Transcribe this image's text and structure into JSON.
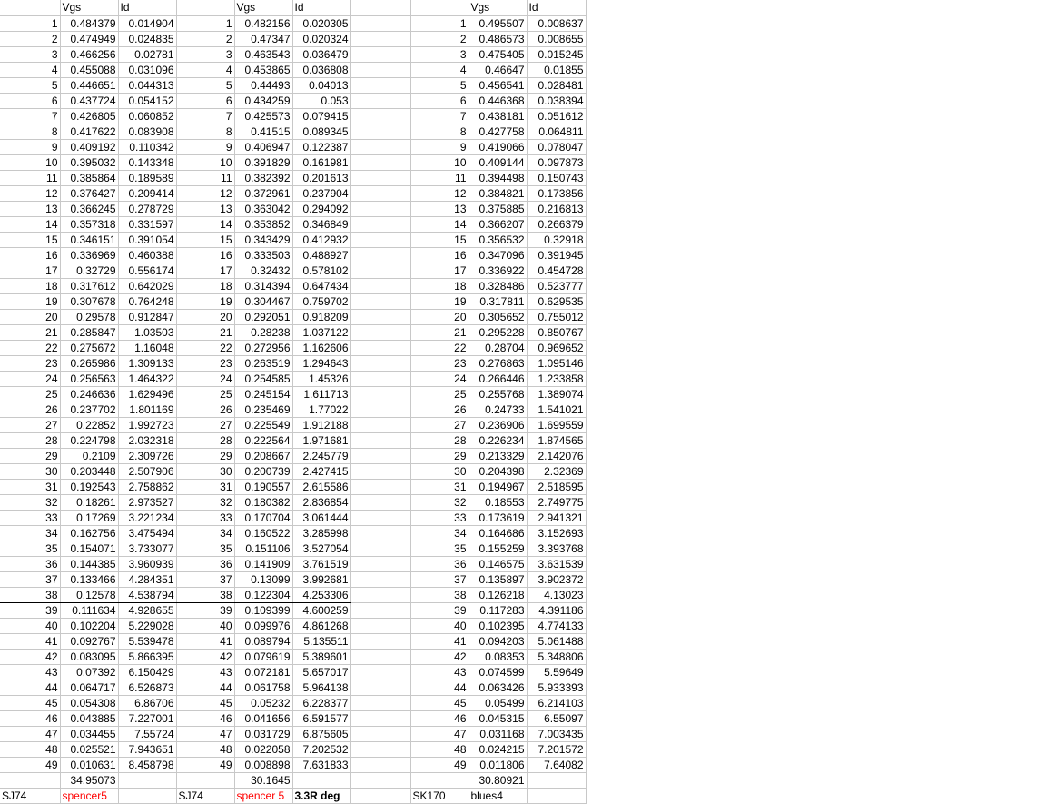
{
  "header": {
    "vgs": "Vgs",
    "id": "Id"
  },
  "groups": [
    {
      "rows": [
        [
          "0.484379",
          "0.014904"
        ],
        [
          "0.474949",
          "0.024835"
        ],
        [
          "0.466256",
          "0.02781"
        ],
        [
          "0.455088",
          "0.031096"
        ],
        [
          "0.446651",
          "0.044313"
        ],
        [
          "0.437724",
          "0.054152"
        ],
        [
          "0.426805",
          "0.060852"
        ],
        [
          "0.417622",
          "0.083908"
        ],
        [
          "0.409192",
          "0.110342"
        ],
        [
          "0.395032",
          "0.143348"
        ],
        [
          "0.385864",
          "0.189589"
        ],
        [
          "0.376427",
          "0.209414"
        ],
        [
          "0.366245",
          "0.278729"
        ],
        [
          "0.357318",
          "0.331597"
        ],
        [
          "0.346151",
          "0.391054"
        ],
        [
          "0.336969",
          "0.460388"
        ],
        [
          "0.32729",
          "0.556174"
        ],
        [
          "0.317612",
          "0.642029"
        ],
        [
          "0.307678",
          "0.764248"
        ],
        [
          "0.29578",
          "0.912847"
        ],
        [
          "0.285847",
          "1.03503"
        ],
        [
          "0.275672",
          "1.16048"
        ],
        [
          "0.265986",
          "1.309133"
        ],
        [
          "0.256563",
          "1.464322"
        ],
        [
          "0.246636",
          "1.629496"
        ],
        [
          "0.237702",
          "1.801169"
        ],
        [
          "0.22852",
          "1.992723"
        ],
        [
          "0.224798",
          "2.032318"
        ],
        [
          "0.2109",
          "2.309726"
        ],
        [
          "0.203448",
          "2.507906"
        ],
        [
          "0.192543",
          "2.758862"
        ],
        [
          "0.18261",
          "2.973527"
        ],
        [
          "0.17269",
          "3.221234"
        ],
        [
          "0.162756",
          "3.475494"
        ],
        [
          "0.154071",
          "3.733077"
        ],
        [
          "0.144385",
          "3.960939"
        ],
        [
          "0.133466",
          "4.284351"
        ],
        [
          "0.12578",
          "4.538794"
        ],
        [
          "0.111634",
          "4.928655"
        ],
        [
          "0.102204",
          "5.229028"
        ],
        [
          "0.092767",
          "5.539478"
        ],
        [
          "0.083095",
          "5.866395"
        ],
        [
          "0.07392",
          "6.150429"
        ],
        [
          "0.064717",
          "6.526873"
        ],
        [
          "0.054308",
          "6.86706"
        ],
        [
          "0.043885",
          "7.227001"
        ],
        [
          "0.034455",
          "7.55724"
        ],
        [
          "0.025521",
          "7.943651"
        ],
        [
          "0.010631",
          "8.458798"
        ]
      ],
      "total": "34.95073",
      "footer_device": "SJ74",
      "footer_name": "spencer5",
      "footer_extra": ""
    },
    {
      "rows": [
        [
          "0.482156",
          "0.020305"
        ],
        [
          "0.47347",
          "0.020324"
        ],
        [
          "0.463543",
          "0.036479"
        ],
        [
          "0.453865",
          "0.036808"
        ],
        [
          "0.44493",
          "0.04013"
        ],
        [
          "0.434259",
          "0.053"
        ],
        [
          "0.425573",
          "0.079415"
        ],
        [
          "0.41515",
          "0.089345"
        ],
        [
          "0.406947",
          "0.122387"
        ],
        [
          "0.391829",
          "0.161981"
        ],
        [
          "0.382392",
          "0.201613"
        ],
        [
          "0.372961",
          "0.237904"
        ],
        [
          "0.363042",
          "0.294092"
        ],
        [
          "0.353852",
          "0.346849"
        ],
        [
          "0.343429",
          "0.412932"
        ],
        [
          "0.333503",
          "0.488927"
        ],
        [
          "0.32432",
          "0.578102"
        ],
        [
          "0.314394",
          "0.647434"
        ],
        [
          "0.304467",
          "0.759702"
        ],
        [
          "0.292051",
          "0.918209"
        ],
        [
          "0.28238",
          "1.037122"
        ],
        [
          "0.272956",
          "1.162606"
        ],
        [
          "0.263519",
          "1.294643"
        ],
        [
          "0.254585",
          "1.45326"
        ],
        [
          "0.245154",
          "1.611713"
        ],
        [
          "0.235469",
          "1.77022"
        ],
        [
          "0.225549",
          "1.912188"
        ],
        [
          "0.222564",
          "1.971681"
        ],
        [
          "0.208667",
          "2.245779"
        ],
        [
          "0.200739",
          "2.427415"
        ],
        [
          "0.190557",
          "2.615586"
        ],
        [
          "0.180382",
          "2.836854"
        ],
        [
          "0.170704",
          "3.061444"
        ],
        [
          "0.160522",
          "3.285998"
        ],
        [
          "0.151106",
          "3.527054"
        ],
        [
          "0.141909",
          "3.761519"
        ],
        [
          "0.13099",
          "3.992681"
        ],
        [
          "0.122304",
          "4.253306"
        ],
        [
          "0.109399",
          "4.600259"
        ],
        [
          "0.099976",
          "4.861268"
        ],
        [
          "0.089794",
          "5.135511"
        ],
        [
          "0.079619",
          "5.389601"
        ],
        [
          "0.072181",
          "5.657017"
        ],
        [
          "0.061758",
          "5.964138"
        ],
        [
          "0.05232",
          "6.228377"
        ],
        [
          "0.041656",
          "6.591577"
        ],
        [
          "0.031729",
          "6.875605"
        ],
        [
          "0.022058",
          "7.202532"
        ],
        [
          "0.008898",
          "7.631833"
        ]
      ],
      "total": "30.1645",
      "footer_device": "SJ74",
      "footer_name": "spencer 5",
      "footer_extra": "3.3R deg"
    },
    {
      "rows": [
        [
          "0.495507",
          "0.008637"
        ],
        [
          "0.486573",
          "0.008655"
        ],
        [
          "0.475405",
          "0.015245"
        ],
        [
          "0.46647",
          "0.01855"
        ],
        [
          "0.456541",
          "0.028481"
        ],
        [
          "0.446368",
          "0.038394"
        ],
        [
          "0.438181",
          "0.051612"
        ],
        [
          "0.427758",
          "0.064811"
        ],
        [
          "0.419066",
          "0.078047"
        ],
        [
          "0.409144",
          "0.097873"
        ],
        [
          "0.394498",
          "0.150743"
        ],
        [
          "0.384821",
          "0.173856"
        ],
        [
          "0.375885",
          "0.216813"
        ],
        [
          "0.366207",
          "0.266379"
        ],
        [
          "0.356532",
          "0.32918"
        ],
        [
          "0.347096",
          "0.391945"
        ],
        [
          "0.336922",
          "0.454728"
        ],
        [
          "0.328486",
          "0.523777"
        ],
        [
          "0.317811",
          "0.629535"
        ],
        [
          "0.305652",
          "0.755012"
        ],
        [
          "0.295228",
          "0.850767"
        ],
        [
          "0.28704",
          "0.969652"
        ],
        [
          "0.276863",
          "1.095146"
        ],
        [
          "0.266446",
          "1.233858"
        ],
        [
          "0.255768",
          "1.389074"
        ],
        [
          "0.24733",
          "1.541021"
        ],
        [
          "0.236906",
          "1.699559"
        ],
        [
          "0.226234",
          "1.874565"
        ],
        [
          "0.213329",
          "2.142076"
        ],
        [
          "0.204398",
          "2.32369"
        ],
        [
          "0.194967",
          "2.518595"
        ],
        [
          "0.18553",
          "2.749775"
        ],
        [
          "0.173619",
          "2.941321"
        ],
        [
          "0.164686",
          "3.152693"
        ],
        [
          "0.155259",
          "3.393768"
        ],
        [
          "0.146575",
          "3.631539"
        ],
        [
          "0.135897",
          "3.902372"
        ],
        [
          "0.126218",
          "4.13023"
        ],
        [
          "0.117283",
          "4.391186"
        ],
        [
          "0.102395",
          "4.774133"
        ],
        [
          "0.094203",
          "5.061488"
        ],
        [
          "0.08353",
          "5.348806"
        ],
        [
          "0.074599",
          "5.59649"
        ],
        [
          "0.063426",
          "5.933393"
        ],
        [
          "0.05499",
          "6.214103"
        ],
        [
          "0.045315",
          "6.55097"
        ],
        [
          "0.031168",
          "7.003435"
        ],
        [
          "0.024215",
          "7.201572"
        ],
        [
          "0.011806",
          "7.64082"
        ]
      ],
      "total": "30.80921",
      "footer_device": "SK170",
      "footer_name": "blues4",
      "footer_extra": ""
    }
  ]
}
